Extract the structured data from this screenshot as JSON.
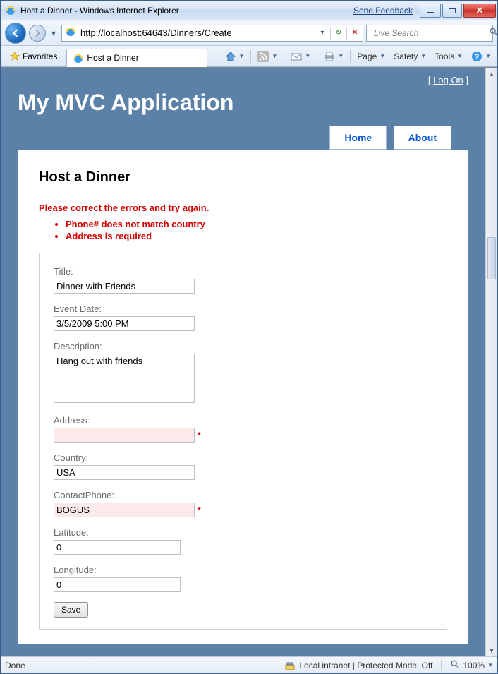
{
  "window": {
    "title": "Host a Dinner - Windows Internet Explorer",
    "feedback": "Send Feedback"
  },
  "nav": {
    "url": "http://localhost:64643/Dinners/Create",
    "search_placeholder": "Live Search"
  },
  "tabbar": {
    "favorites": "Favorites",
    "tab_title": "Host a Dinner",
    "menu": {
      "page": "Page",
      "safety": "Safety",
      "tools": "Tools"
    }
  },
  "app": {
    "logon_prefix": "[ ",
    "logon_link": "Log On",
    "logon_suffix": " ]",
    "title": "My MVC Application",
    "menu": {
      "home": "Home",
      "about": "About"
    }
  },
  "page": {
    "heading": "Host a Dinner",
    "summary": "Please correct the errors and try again.",
    "errors": [
      "Phone# does not match country",
      "Address is required"
    ],
    "labels": {
      "title": "Title:",
      "eventdate": "Event Date:",
      "description": "Description:",
      "address": "Address:",
      "country": "Country:",
      "contactphone": "ContactPhone:",
      "latitude": "Latitude:",
      "longitude": "Longitude:"
    },
    "values": {
      "title": "Dinner with Friends",
      "eventdate": "3/5/2009 5:00 PM",
      "description": "Hang out with friends",
      "address": "",
      "country": "USA",
      "contactphone": "BOGUS",
      "latitude": "0",
      "longitude": "0"
    },
    "asterisk": "*",
    "save": "Save"
  },
  "status": {
    "done": "Done",
    "zone": "Local intranet | Protected Mode: Off",
    "zoom": "100%"
  }
}
